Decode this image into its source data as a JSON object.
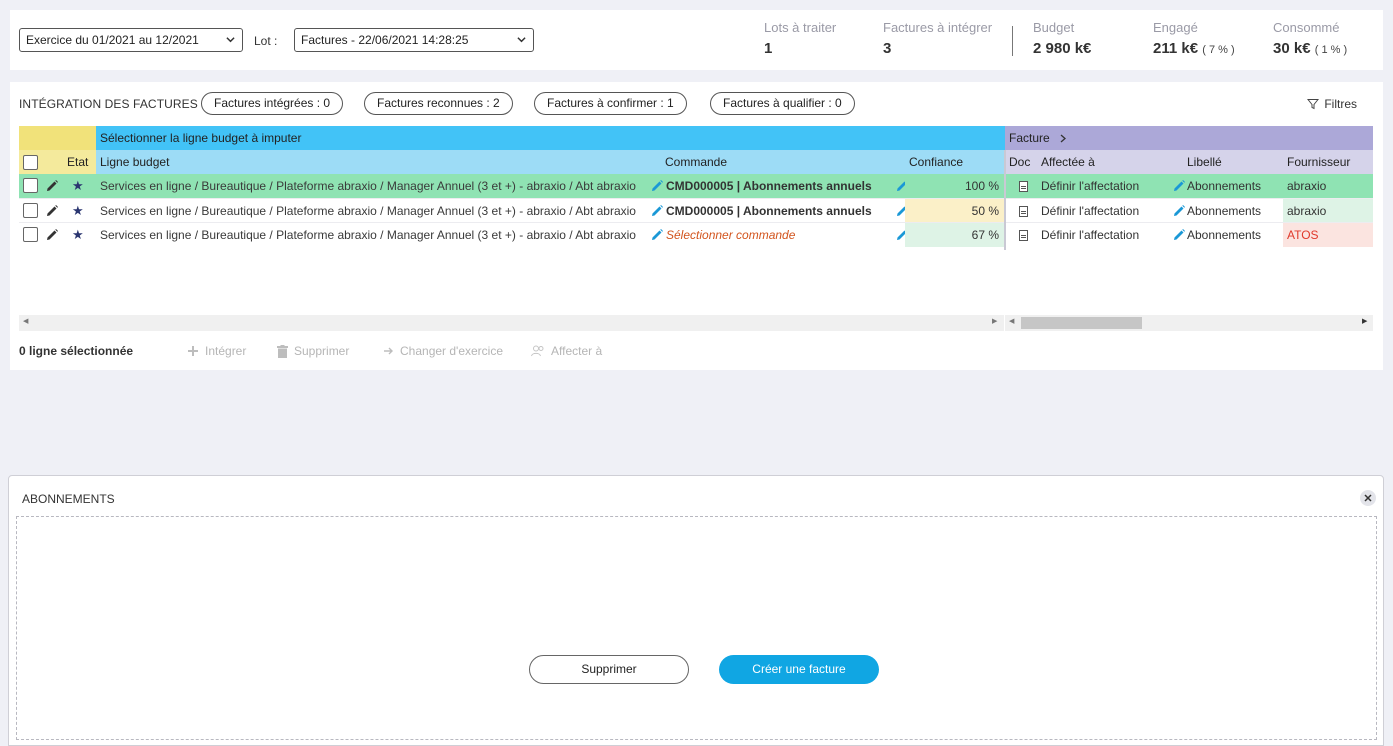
{
  "toolbar": {
    "exercise_select": "Exercice du 01/2021 au 12/2021",
    "lot_label": "Lot :",
    "lot_select": "Factures - 22/06/2021 14:28:25"
  },
  "stats": [
    {
      "label": "Lots à traiter",
      "value": "1",
      "pct": ""
    },
    {
      "label": "Factures à intégrer",
      "value": "3",
      "pct": ""
    },
    {
      "label": "Budget",
      "value": "2 980 k€",
      "pct": ""
    },
    {
      "label": "Engagé",
      "value": "211 k€",
      "pct": "( 7 % )"
    },
    {
      "label": "Consommé",
      "value": "30 k€",
      "pct": "( 1 % )"
    }
  ],
  "integration": {
    "title": "INTÉGRATION DES FACTURES",
    "pills": [
      "Factures intégrées : 0",
      "Factures reconnues : 2",
      "Factures à confirmer : 1",
      "Factures à qualifier : 0"
    ],
    "filters_label": "Filtres"
  },
  "grid": {
    "band_budget": "Sélectionner la ligne budget à imputer",
    "band_facture": "Facture",
    "headers": {
      "etat": "Etat",
      "ligne_budget": "Ligne budget",
      "commande": "Commande",
      "confiance": "Confiance",
      "doc": "Doc",
      "affectee": "Affectée à",
      "libelle": "Libellé",
      "fournisseur": "Fournisseur"
    },
    "rows": [
      {
        "ligne_budget": "Services en ligne / Bureautique / Plateforme abraxio / Manager Annuel (3 et +) - abraxio / Abt abraxio",
        "commande": "CMD000005 | Abonnements annuels",
        "confiance": "100 %",
        "affectee": "Définir l'affectation",
        "libelle": "Abonnements",
        "fournisseur": "abraxio"
      },
      {
        "ligne_budget": "Services en ligne / Bureautique / Plateforme abraxio / Manager Annuel (3 et +) - abraxio / Abt abraxio",
        "commande": "CMD000005 | Abonnements annuels",
        "confiance": "50 %",
        "affectee": "Définir l'affectation",
        "libelle": "Abonnements",
        "fournisseur": "abraxio"
      },
      {
        "ligne_budget": "Services en ligne / Bureautique / Plateforme abraxio / Manager Annuel (3 et +) - abraxio / Abt abraxio",
        "commande": "Sélectionner commande",
        "confiance": "67 %",
        "affectee": "Définir l'affectation",
        "libelle": "Abonnements",
        "fournisseur": "ATOS"
      }
    ]
  },
  "actions": {
    "selected_count": "0 ligne sélectionnée",
    "integrer": "Intégrer",
    "supprimer": "Supprimer",
    "changer_exercice": "Changer d'exercice",
    "affecter": "Affecter à"
  },
  "bottom_panel": {
    "title": "ABONNEMENTS",
    "delete_button": "Supprimer",
    "create_button": "Créer une facture"
  },
  "colors": {
    "accent_blue": "#10a6e3",
    "row_green": "#8fe3b3",
    "conf_yellow": "#fbf0c8",
    "conf_green": "#def3e6",
    "warning_text": "#d2541d"
  }
}
